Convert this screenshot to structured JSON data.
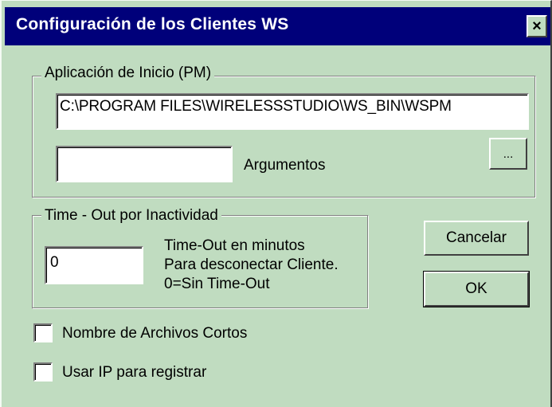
{
  "window": {
    "title": "Configuración de los Clientes WS",
    "close_glyph": "×"
  },
  "app_group": {
    "legend": "Aplicación de Inicio (PM)",
    "path_value": "C:\\PROGRAM FILES\\WIRELESSSTUDIO\\WS_BIN\\WSPM",
    "args_value": "",
    "args_label": "Argumentos",
    "browse_label": "..."
  },
  "timeout_group": {
    "legend": "Time - Out por Inactividad",
    "value": "0",
    "desc_line1": "Time-Out en minutos",
    "desc_line2": "Para desconectar Cliente.",
    "desc_line3": "0=Sin Time-Out"
  },
  "buttons": {
    "cancel": "Cancelar",
    "ok": "OK"
  },
  "options": {
    "short_names_label": "Nombre de Archivos Cortos",
    "short_names_checked": false,
    "use_ip_label": "Usar IP para registrar",
    "use_ip_checked": false
  },
  "colors": {
    "dialog_bg": "#c0dcc0",
    "titlebar_bg": "#00007a"
  }
}
